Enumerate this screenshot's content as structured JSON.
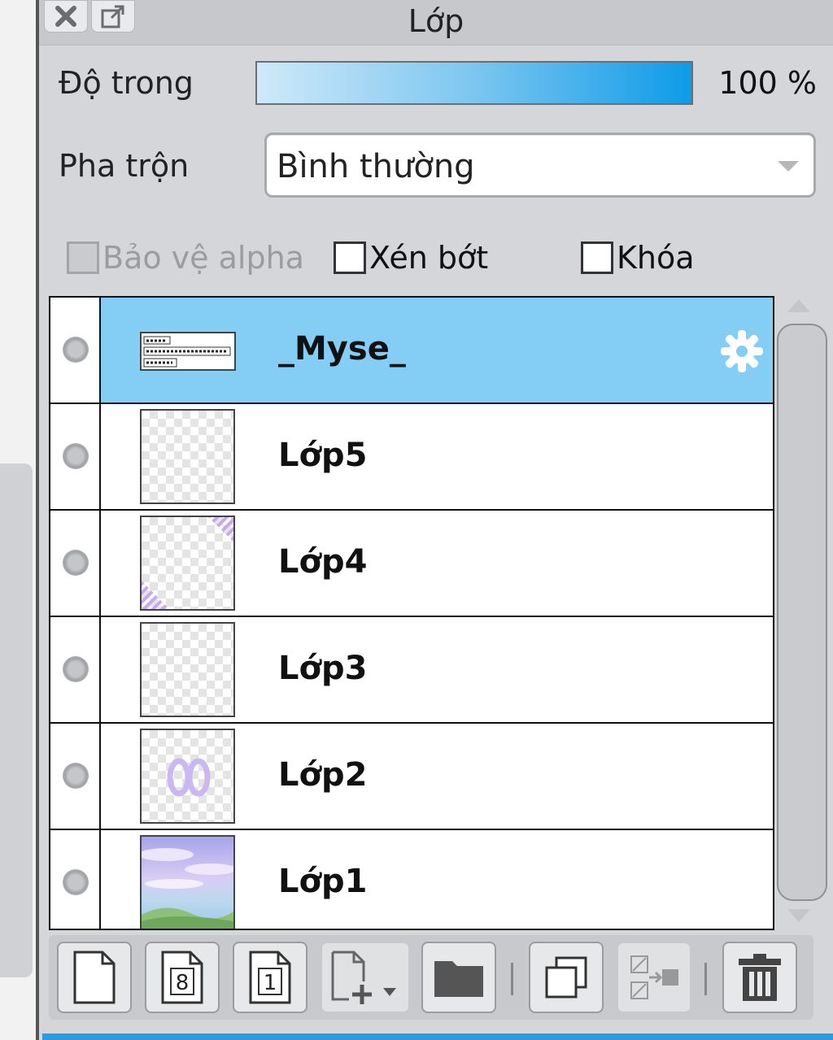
{
  "panel": {
    "title": "Lớp",
    "close_icon": "close-icon",
    "popout_icon": "popout-icon"
  },
  "opacity": {
    "label": "Độ trong",
    "value_text": "100 %",
    "value": 100
  },
  "blend": {
    "label": "Pha trộn",
    "selected": "Bình thường"
  },
  "options": {
    "protect_alpha": "Bảo vệ alpha",
    "clipping": "Xén bớt",
    "lock": "Khóa"
  },
  "layers": [
    {
      "name": "_Myse_",
      "selected": true,
      "thumb": "text",
      "icon": "gear-icon"
    },
    {
      "name": "Lớp5",
      "selected": false,
      "thumb": "empty"
    },
    {
      "name": "Lớp4",
      "selected": false,
      "thumb": "stripes"
    },
    {
      "name": "Lớp3",
      "selected": false,
      "thumb": "empty"
    },
    {
      "name": "Lớp2",
      "selected": false,
      "thumb": "number"
    },
    {
      "name": "Lớp1",
      "selected": false,
      "thumb": "sky"
    }
  ],
  "toolbar": {
    "buttons": [
      {
        "icon": "new-layer-icon"
      },
      {
        "icon": "new-8bit-layer-icon",
        "glyph": "8"
      },
      {
        "icon": "new-1bit-layer-icon",
        "glyph": "1"
      },
      {
        "icon": "add-layer-dropdown-icon"
      },
      {
        "icon": "folder-icon"
      },
      {
        "icon": "duplicate-layer-icon"
      },
      {
        "icon": "merge-layer-icon"
      },
      {
        "icon": "delete-layer-icon"
      }
    ]
  },
  "colors": {
    "selected_row": "#84cdf5",
    "accent": "#2a9be0"
  }
}
